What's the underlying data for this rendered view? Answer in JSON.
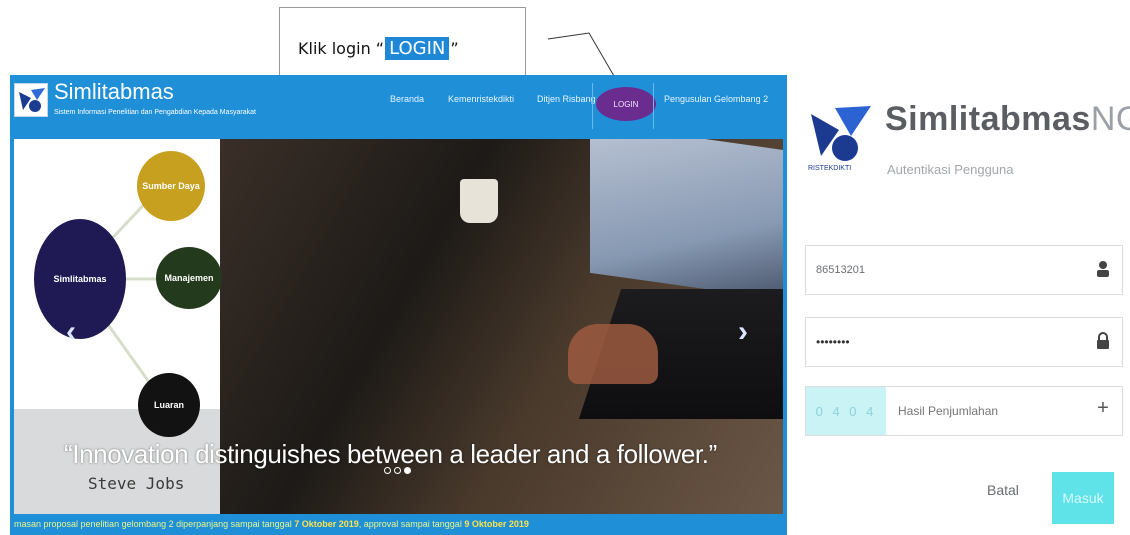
{
  "callout": {
    "prefix": "Klik login “",
    "chip": "LOGIN",
    "suffix": "”"
  },
  "site": {
    "brand": "Simlitabmas",
    "tagline": "Sistem Informasi Penelitian dan Pengabdian Kepada Masyarakat",
    "nav": {
      "beranda": "Beranda",
      "kemen": "Kemenristekdikti",
      "ditjen": "Ditjen Risbang",
      "login": "LOGIN",
      "pengusulan": "Pengusulan Gelombang 2"
    },
    "mindmap": {
      "main": "Simlitabmas",
      "sumber_daya": "Sumber Daya",
      "manajemen": "Manajemen",
      "luaran": "Luaran"
    },
    "quote": "“Innovation distinguishes between a leader and a follower.”",
    "author": "Steve Jobs",
    "ticker": {
      "text1": "masan proposal penelitian gelombang 2 diperpanjang sampai tanggal ",
      "date1": "7 Oktober 2019",
      "text2": ", approval sampai tanggal ",
      "date2": "9 Oktober 2019"
    },
    "icons": {
      "prev": "chevron-left-icon",
      "next": "chevron-right-icon"
    }
  },
  "login": {
    "title": "Simlitabmas",
    "title_suffix": "NG",
    "subtitle": "Autentikasi Pengguna",
    "username_value": "86513201",
    "password_value": "••••••••",
    "captcha": "0 4 0 4",
    "captcha_placeholder": "Hasil Penjumlahan",
    "batal": "Batal",
    "masuk": "Masuk",
    "colors": {
      "accent": "#5fe3e8",
      "site_blue": "#1f8fd8",
      "login_highlight": "#6a2c8f"
    }
  }
}
